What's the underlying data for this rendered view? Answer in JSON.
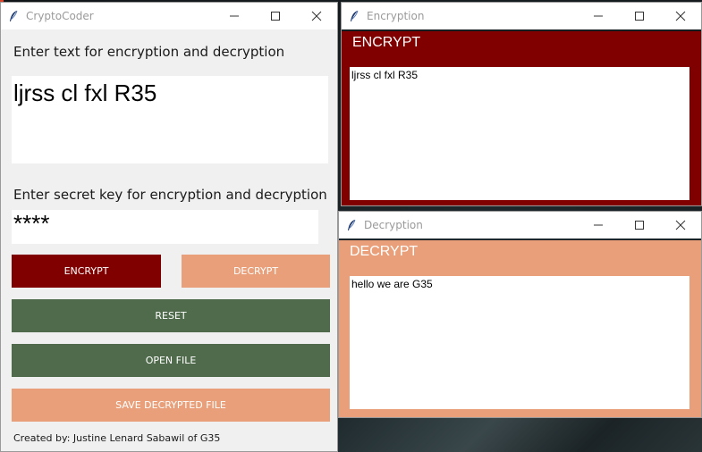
{
  "main_window": {
    "title": "CryptoCoder",
    "text_label": "Enter text for encryption and decryption",
    "text_value": "ljrss cl fxl R35",
    "key_label": "Enter secret key for encryption and decryption",
    "key_value": "****",
    "buttons": {
      "encrypt": "ENCRYPT",
      "decrypt": "DECRYPT",
      "reset": "RESET",
      "open_file": "OPEN FILE",
      "save": "SAVE DECRYPTED FILE"
    },
    "credit": "Created by: Justine Lenard Sabawil of G35"
  },
  "encryption_window": {
    "title": "Encryption",
    "heading": "ENCRYPT",
    "output": "ljrss cl fxl R35"
  },
  "decryption_window": {
    "title": "Decryption",
    "heading": "DECRYPT",
    "output": "hello we are G35"
  },
  "colors": {
    "encrypt": "#800000",
    "decrypt": "#e9a07a",
    "reset": "#4f6b4c",
    "open_file": "#4f6b4c",
    "save": "#e9a07a",
    "window_bg": "#f0f0f0"
  },
  "icons": [
    "feather-icon",
    "minimize-icon",
    "maximize-icon",
    "close-icon"
  ]
}
